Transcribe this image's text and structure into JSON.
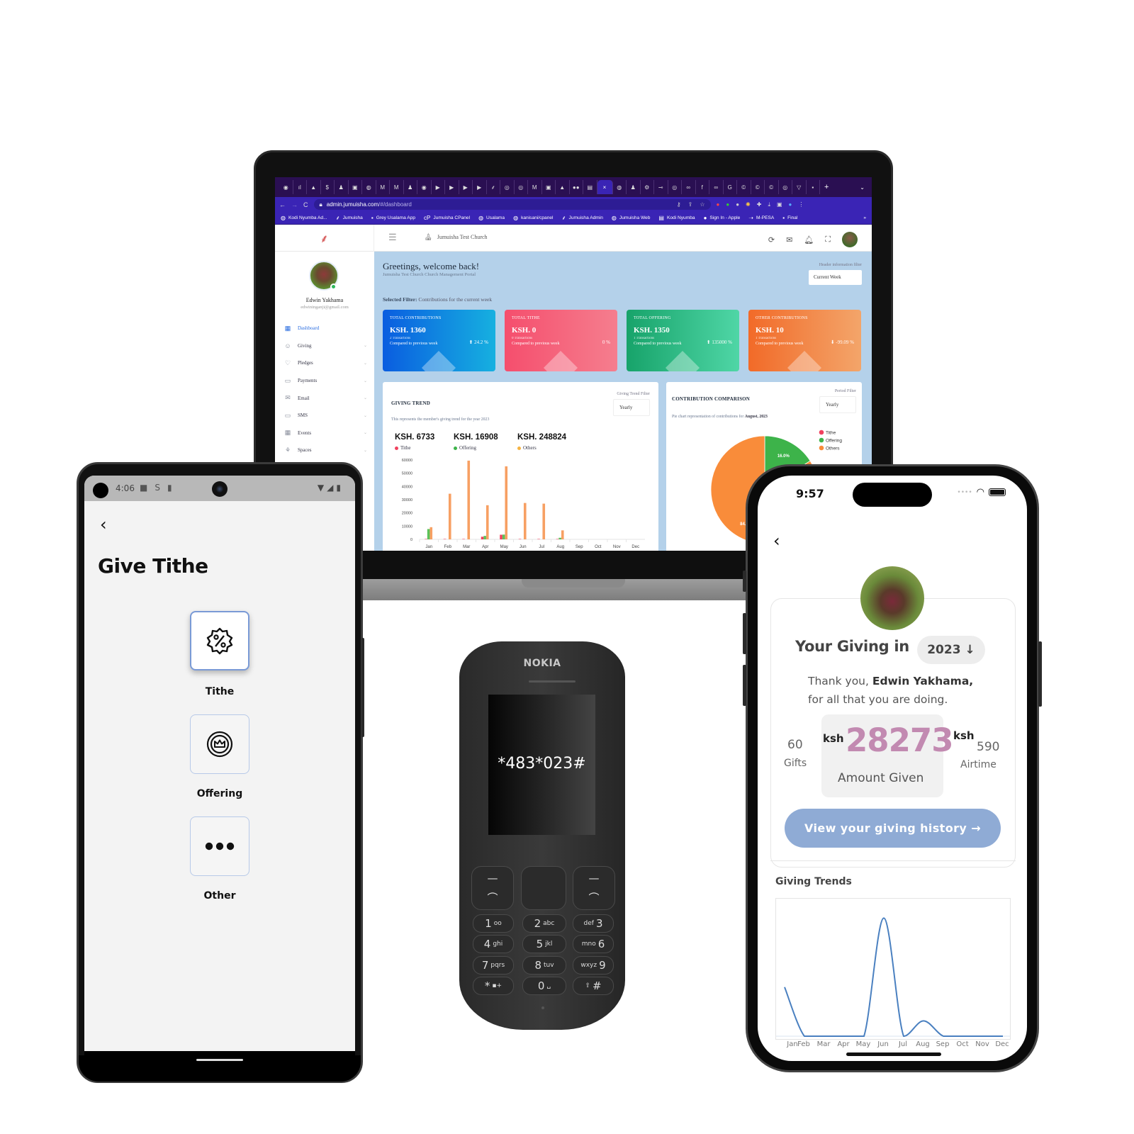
{
  "laptop": {
    "browser": {
      "tab_count_visible": 41,
      "active_tab_close": "×",
      "new_tab": "+",
      "url_host": "admin.jumuisha.com",
      "url_path": "/#/dashboard",
      "bookmarks": [
        {
          "icon": "globe-icon",
          "label": "Kodi Nyumba Ad..."
        },
        {
          "icon": "jumuisha-icon",
          "label": "Jumuisha"
        },
        {
          "icon": "xd-icon",
          "label": "Grey Usalama App"
        },
        {
          "icon": "cpanel-icon",
          "label": "Jumuisha CPanel"
        },
        {
          "icon": "globe-icon",
          "label": "Usalama"
        },
        {
          "icon": "globe-icon",
          "label": "kanisani/cpanel"
        },
        {
          "icon": "jumuisha-icon",
          "label": "Jumuisha Admin"
        },
        {
          "icon": "globe-icon",
          "label": "Jumuisha Web"
        },
        {
          "icon": "kodi-icon",
          "label": "Kodi Nyumba"
        },
        {
          "icon": "apple-icon",
          "label": "Sign In - Apple"
        },
        {
          "icon": "mpesa-icon",
          "label": "M-PESA"
        },
        {
          "icon": "xd-icon",
          "label": "Final"
        }
      ],
      "bookmarks_more": "»"
    },
    "app": {
      "church_name": "Jumuisha Test Church",
      "user": {
        "name": "Edwin Yakhama",
        "email": "edwininganji@gmail.com"
      },
      "nav": [
        {
          "label": "Dashboard",
          "icon": "dashboard-icon",
          "active": true
        },
        {
          "label": "Giving",
          "icon": "smile-icon"
        },
        {
          "label": "Pledges",
          "icon": "pledge-hand-icon"
        },
        {
          "label": "Payments",
          "icon": "payments-icon"
        },
        {
          "label": "Email",
          "icon": "email-icon"
        },
        {
          "label": "SMS",
          "icon": "sms-icon"
        },
        {
          "label": "Events",
          "icon": "calendar-icon"
        },
        {
          "label": "Spaces",
          "icon": "spaces-icon"
        }
      ],
      "greeting": "Greetings, welcome back!",
      "greeting_sub": "Jumuisha Test Church Church Management Portal",
      "header_filter_label": "Header information filter",
      "header_filter_value": "Current Week",
      "selected_filter_label": "Selected Filter:",
      "selected_filter_value": "Contributions for the current week",
      "cards": [
        {
          "title": "TOTAL CONTRIBUTIONS",
          "value": "KSH. 1360",
          "transactions": "2 Transactions",
          "compare": "Compared to previous week",
          "change": "24.2 %",
          "direction": "up"
        },
        {
          "title": "TOTAL TITHE",
          "value": "KSH. 0",
          "transactions": "0 Transactions",
          "compare": "Compared to previous week",
          "change": "0 %",
          "direction": "none"
        },
        {
          "title": "TOTAL OFFERING",
          "value": "KSH. 1350",
          "transactions": "1 Transactions",
          "compare": "Compared to previous week",
          "change": "135000 %",
          "direction": "up"
        },
        {
          "title": "OTHER CONTRIBUTIONS",
          "value": "KSH. 10",
          "transactions": "1 Transactions",
          "compare": "Compared to previous week",
          "change": "-99.09 %",
          "direction": "down"
        }
      ],
      "giving_trend": {
        "title": "GIVING TREND",
        "subtitle": "This represents the member's giving trend for the year 2023",
        "filter_label": "Giving Trend Filter",
        "filter_value": "Yearly",
        "totals": [
          {
            "value": "KSH. 6733",
            "label": "Tithe",
            "color": "#f0415e"
          },
          {
            "value": "KSH. 16908",
            "label": "Offering",
            "color": "#3db34a"
          },
          {
            "value": "KSH. 248824",
            "label": "Others",
            "color": "#f5b342"
          }
        ]
      },
      "comparison": {
        "title": "CONTRIBUTION COMPARISON",
        "subtitle_prefix": "Pie chart representation of contributions for",
        "subtitle_period": "August, 2023",
        "filter_label": "Period Filter",
        "filter_value": "Yearly"
      }
    }
  },
  "chart_data": [
    {
      "type": "bar",
      "title": "GIVING TREND",
      "categories": [
        "Jan",
        "Feb",
        "Mar",
        "Apr",
        "May",
        "Jun",
        "Jul",
        "Aug",
        "Sep",
        "Oct",
        "Nov",
        "Dec"
      ],
      "series": [
        {
          "name": "Tithe",
          "color": "#f0415e",
          "values": [
            300,
            300,
            300,
            2000,
            3500,
            300,
            300,
            300,
            0,
            0,
            0,
            0
          ]
        },
        {
          "name": "Offering",
          "color": "#5cc25a",
          "values": [
            7800,
            0,
            0,
            2600,
            3600,
            0,
            0,
            1200,
            0,
            0,
            0,
            0
          ]
        },
        {
          "name": "Others",
          "color": "#f7a063",
          "values": [
            9200,
            34500,
            59500,
            25800,
            55200,
            27500,
            27000,
            6800,
            0,
            0,
            0,
            0
          ]
        }
      ],
      "yticks": [
        0,
        10000,
        20000,
        30000,
        40000,
        50000,
        60000
      ],
      "ylim": [
        0,
        60000
      ],
      "grid": false,
      "legend": "top-left"
    },
    {
      "type": "pie",
      "title": "CONTRIBUTION COMPARISON",
      "categories": [
        "Tithe",
        "Offering",
        "Others"
      ],
      "values": [
        0,
        16.0,
        84.0
      ],
      "colors": [
        "#f0415e",
        "#3db34a",
        "#f98c3a"
      ],
      "labels": [
        "",
        "16.0%",
        "84.0%"
      ],
      "legend": "right"
    },
    {
      "type": "line",
      "title": "Giving Trends",
      "categories": [
        "Jan",
        "Feb",
        "Mar",
        "Apr",
        "May",
        "Jun",
        "Jul",
        "Aug",
        "Sep",
        "Oct",
        "Nov",
        "Dec"
      ],
      "series": [
        {
          "name": "Giving",
          "color": "#4a80c0",
          "values": [
            3200,
            0,
            0,
            0,
            0,
            7700,
            0,
            1000,
            0,
            0,
            0,
            0
          ]
        }
      ],
      "ylim": [
        0,
        8500
      ],
      "grid": false
    }
  ],
  "android": {
    "status_time": "4:06",
    "title": "Give Tithe",
    "options": [
      {
        "label": "Tithe",
        "icon": "percent-badge-icon",
        "selected": true
      },
      {
        "label": "Offering",
        "icon": "crown-coin-icon",
        "selected": false
      },
      {
        "label": "Other",
        "icon": "more-dots-icon",
        "selected": false
      }
    ]
  },
  "nokia": {
    "brand": "NOKIA",
    "ussd_code": "*483*023#",
    "keys": [
      {
        "main": "1",
        "sub": "oo"
      },
      {
        "main": "2",
        "sub": "abc"
      },
      {
        "main": "3",
        "sub": "def"
      },
      {
        "main": "4",
        "sub": "ghi"
      },
      {
        "main": "5",
        "sub": "jkl"
      },
      {
        "main": "6",
        "sub": "mno"
      },
      {
        "main": "7",
        "sub": "pqrs"
      },
      {
        "main": "8",
        "sub": "tuv"
      },
      {
        "main": "9",
        "sub": "wxyz"
      },
      {
        "main": "*",
        "sub": "▪+"
      },
      {
        "main": "0",
        "sub": "␣"
      },
      {
        "main": "#",
        "sub": "⇧"
      }
    ]
  },
  "iphone": {
    "status_time": "9:57",
    "heading": "Your Giving in",
    "year": "2023",
    "thanks_prefix": "Thank you,",
    "thanks_name": "Edwin Yakhama,",
    "thanks_suffix": "for all that you are doing.",
    "gifts_count": "60",
    "gifts_label": "Gifts",
    "currency": "ksh",
    "amount_given": "28273",
    "amount_label": "Amount Given",
    "airtime": "590",
    "airtime_label": "Airtime",
    "history_button": "View your giving history →",
    "trends_title": "Giving Trends"
  }
}
